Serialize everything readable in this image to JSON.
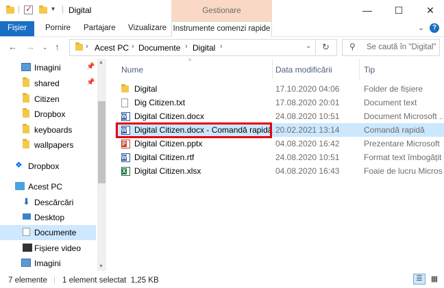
{
  "window": {
    "title": "Digital",
    "context_tab_group": "Gestionare",
    "buttons": {
      "minimize": "—",
      "maximize": "☐",
      "close": "✕"
    }
  },
  "ribbon": {
    "tabs": [
      {
        "label": "Fișier"
      },
      {
        "label": "Pornire"
      },
      {
        "label": "Partajare"
      },
      {
        "label": "Vizualizare"
      },
      {
        "label": "Instrumente comenzi rapide"
      }
    ]
  },
  "address": {
    "crumbs": [
      "Acest PC",
      "Documente",
      "Digital"
    ],
    "search_placeholder": "Se caută în \"Digital\""
  },
  "nav": {
    "items": [
      {
        "label": "Imagini",
        "icon": "pictures-icon",
        "pinned": true
      },
      {
        "label": "shared",
        "icon": "folder-icon",
        "pinned": true
      },
      {
        "label": "Citizen",
        "icon": "folder-icon",
        "pinned": false
      },
      {
        "label": "Dropbox",
        "icon": "folder-icon",
        "pinned": false
      },
      {
        "label": "keyboards",
        "icon": "folder-icon",
        "pinned": false
      },
      {
        "label": "wallpapers",
        "icon": "folder-icon",
        "pinned": false
      },
      {
        "label": "Dropbox",
        "icon": "dropbox-icon",
        "pinned": false
      },
      {
        "label": "Acest PC",
        "icon": "computer-icon",
        "pinned": false
      },
      {
        "label": "Descărcări",
        "icon": "download-icon",
        "pinned": false
      },
      {
        "label": "Desktop",
        "icon": "desktop-icon",
        "pinned": false
      },
      {
        "label": "Documente",
        "icon": "documents-icon",
        "pinned": false,
        "selected": true
      },
      {
        "label": "Fișiere video",
        "icon": "video-icon",
        "pinned": false
      },
      {
        "label": "Imagini",
        "icon": "pictures-icon",
        "pinned": false
      }
    ]
  },
  "columns": {
    "name": "Nume",
    "date": "Data modificării",
    "type": "Tip"
  },
  "files": [
    {
      "name": "Digital",
      "date": "17.10.2020 04:06",
      "type": "Folder de fișiere",
      "icon": "folder-icon"
    },
    {
      "name": "Dig Citizen.txt",
      "date": "17.08.2020 20:01",
      "type": "Document text",
      "icon": "text-file-icon"
    },
    {
      "name": "Digital Citizen.docx",
      "date": "24.08.2020 10:51",
      "type": "Document Microsoft ...",
      "icon": "word-file-icon"
    },
    {
      "name": "Digital Citizen.docx - Comandă rapidă",
      "date": "20.02.2021 13:14",
      "type": "Comandă rapidă",
      "icon": "shortcut-icon",
      "selected": true
    },
    {
      "name": "Digital Citizen.pptx",
      "date": "04.08.2020 16:42",
      "type": "Prezentare Microsoft ...",
      "icon": "powerpoint-file-icon"
    },
    {
      "name": "Digital Citizen.rtf",
      "date": "24.08.2020 10:51",
      "type": "Format text îmbogățit",
      "icon": "rtf-file-icon"
    },
    {
      "name": "Digital Citizen.xlsx",
      "date": "04.08.2020 16:43",
      "type": "Foaie de lucru Micros...",
      "icon": "excel-file-icon"
    }
  ],
  "status": {
    "count": "7 elemente",
    "selection": "1 element selectat  1,25 KB"
  }
}
